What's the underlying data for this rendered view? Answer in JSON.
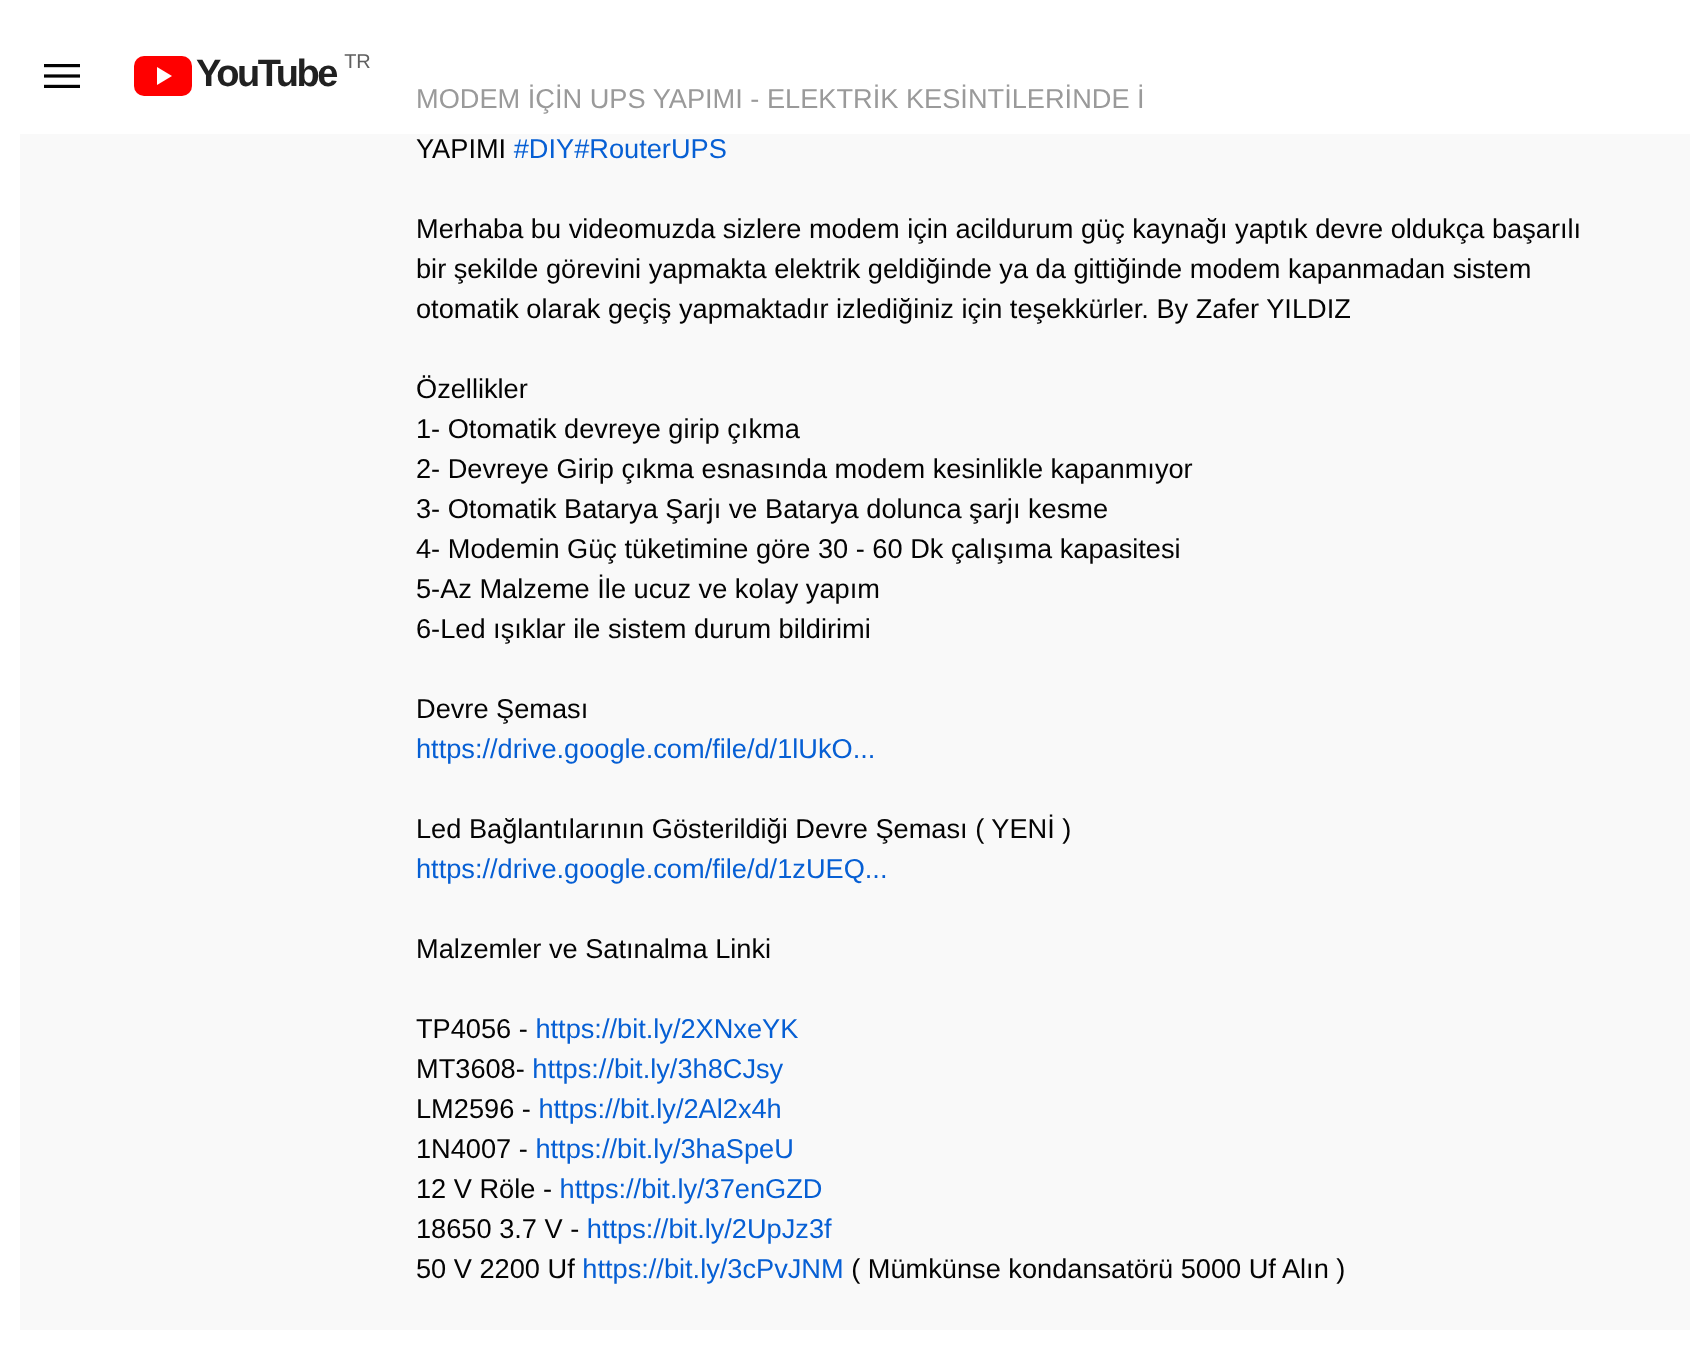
{
  "header": {
    "logo_text": "YouTube",
    "country_code": "TR"
  },
  "faded_line": "MODEM İÇİN UPS YAPIMI - ELEKTRİK KESİNTİLERİNDE İ",
  "description": [
    [
      {
        "parts": [
          {
            "kind": "text",
            "text": "YAPIMI "
          },
          {
            "kind": "link",
            "text": "#DIY"
          },
          {
            "kind": "link",
            "text": "#RouterUPS"
          }
        ]
      }
    ],
    [
      {
        "parts": [
          {
            "kind": "text",
            "text": "Merhaba bu videomuzda sizlere modem için acildurum güç kaynağı yaptık devre oldukça başarılı"
          }
        ]
      },
      {
        "parts": [
          {
            "kind": "text",
            "text": "bir şekilde görevini yapmakta elektrik geldiğinde ya da gittiğinde modem kapanmadan sistem"
          }
        ]
      },
      {
        "parts": [
          {
            "kind": "text",
            "text": "otomatik olarak geçiş yapmaktadır izlediğiniz için teşekkürler. By Zafer YILDIZ"
          }
        ]
      }
    ],
    [
      {
        "parts": [
          {
            "kind": "text",
            "text": "Özellikler"
          }
        ]
      },
      {
        "parts": [
          {
            "kind": "text",
            "text": "1- Otomatik devreye girip çıkma"
          }
        ]
      },
      {
        "parts": [
          {
            "kind": "text",
            "text": "2- Devreye Girip çıkma esnasında modem kesinlikle kapanmıyor"
          }
        ]
      },
      {
        "parts": [
          {
            "kind": "text",
            "text": "3- Otomatik Batarya Şarjı ve Batarya dolunca şarjı kesme"
          }
        ]
      },
      {
        "parts": [
          {
            "kind": "text",
            "text": "4- Modemin Güç tüketimine göre 30 - 60 Dk çalışıma kapasitesi"
          }
        ]
      },
      {
        "parts": [
          {
            "kind": "text",
            "text": "5-Az Malzeme İle ucuz ve kolay yapım"
          }
        ]
      },
      {
        "parts": [
          {
            "kind": "text",
            "text": "6-Led ışıklar ile sistem durum bildirimi"
          }
        ]
      }
    ],
    [
      {
        "parts": [
          {
            "kind": "text",
            "text": "Devre Şeması"
          }
        ]
      },
      {
        "parts": [
          {
            "kind": "link",
            "text": "https://drive.google.com/file/d/1lUkO..."
          }
        ]
      }
    ],
    [
      {
        "parts": [
          {
            "kind": "text",
            "text": "Led Bağlantılarının Gösterildiği Devre Şeması ( YENİ )"
          }
        ]
      },
      {
        "parts": [
          {
            "kind": "link",
            "text": "https://drive.google.com/file/d/1zUEQ..."
          }
        ]
      }
    ],
    [
      {
        "parts": [
          {
            "kind": "text",
            "text": "Malzemler ve Satınalma Linki"
          }
        ]
      }
    ],
    [
      {
        "parts": [
          {
            "kind": "text",
            "text": "TP4056 - "
          },
          {
            "kind": "link",
            "text": "https://bit.ly/2XNxeYK"
          }
        ]
      },
      {
        "parts": [
          {
            "kind": "text",
            "text": "MT3608- "
          },
          {
            "kind": "link",
            "text": "https://bit.ly/3h8CJsy"
          }
        ]
      },
      {
        "parts": [
          {
            "kind": "text",
            "text": "LM2596 - "
          },
          {
            "kind": "link",
            "text": "https://bit.ly/2Al2x4h"
          }
        ]
      },
      {
        "parts": [
          {
            "kind": "text",
            "text": "1N4007 - "
          },
          {
            "kind": "link",
            "text": "https://bit.ly/3haSpeU"
          }
        ]
      },
      {
        "parts": [
          {
            "kind": "text",
            "text": "12 V Röle - "
          },
          {
            "kind": "link",
            "text": "https://bit.ly/37enGZD"
          }
        ]
      },
      {
        "parts": [
          {
            "kind": "text",
            "text": "18650 3.7 V - "
          },
          {
            "kind": "link",
            "text": "https://bit.ly/2UpJz3f"
          }
        ]
      },
      {
        "parts": [
          {
            "kind": "text",
            "text": "50 V 2200 Uf "
          },
          {
            "kind": "link",
            "text": "https://bit.ly/3cPvJNM"
          },
          {
            "kind": "text",
            "text": " ( Mümkünse kondansatörü 5000 Uf Alın )"
          }
        ]
      }
    ]
  ]
}
